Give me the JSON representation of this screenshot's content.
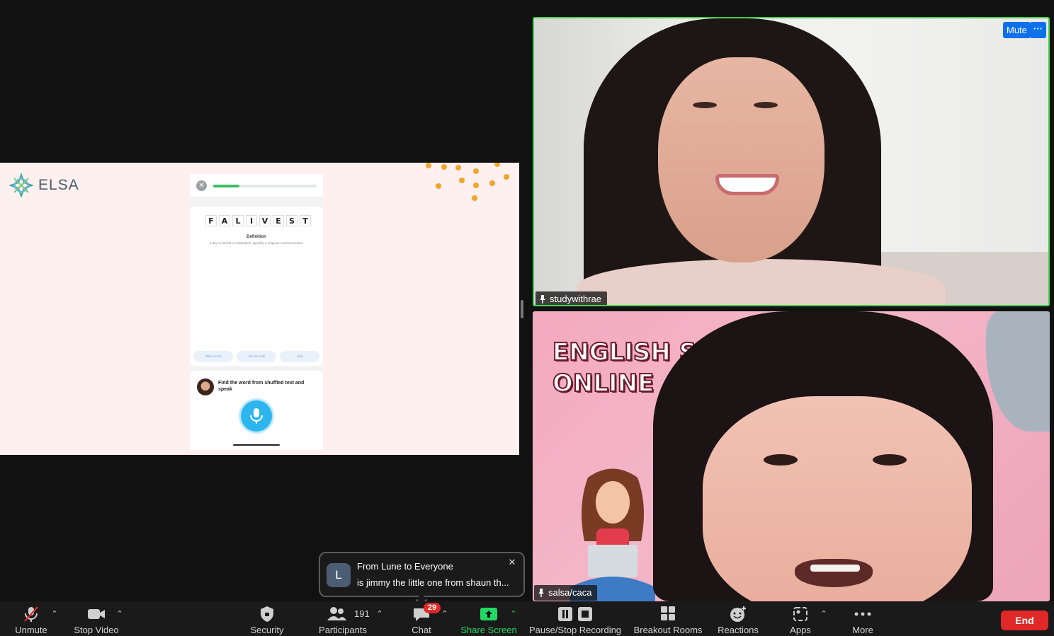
{
  "share": {
    "brand": "ELSA",
    "letters": [
      "F",
      "A",
      "L",
      "I",
      "V",
      "E",
      "S",
      "T"
    ],
    "definition_title": "Definition",
    "definition_text": "a day or period of celebration, typically a religious commemoration",
    "hints": [
      "Take a Hint",
      "Ask for Help",
      "Skip"
    ],
    "instruction": "Find the word from shuffled text and speak",
    "progress_fraction": 0.25
  },
  "tiles": {
    "tile1": {
      "name": "studywithrae",
      "mute_label": "Mute",
      "more_label": "···"
    },
    "tile2": {
      "name": "salsa/caca",
      "background_title_line1": "ENGLISH SP",
      "background_title_line2": "ONLINE",
      "fragment": "th"
    }
  },
  "chat_toast": {
    "avatar_letter": "L",
    "from": "From Lune to Everyone",
    "message": "is jimmy the little one from shaun th..."
  },
  "toolbar": {
    "unmute": "Unmute",
    "stop_video": "Stop Video",
    "security": "Security",
    "participants": "Participants",
    "participants_count": "191",
    "chat": "Chat",
    "chat_badge": "29",
    "share_screen": "Share Screen",
    "recording": "Pause/Stop Recording",
    "breakout": "Breakout Rooms",
    "reactions": "Reactions",
    "apps": "Apps",
    "more": "More",
    "end": "End"
  },
  "colors": {
    "active_speaker_border": "#3fd34a",
    "zoom_blue": "#0e71eb",
    "end_red": "#e02828",
    "share_green": "#23d962"
  }
}
